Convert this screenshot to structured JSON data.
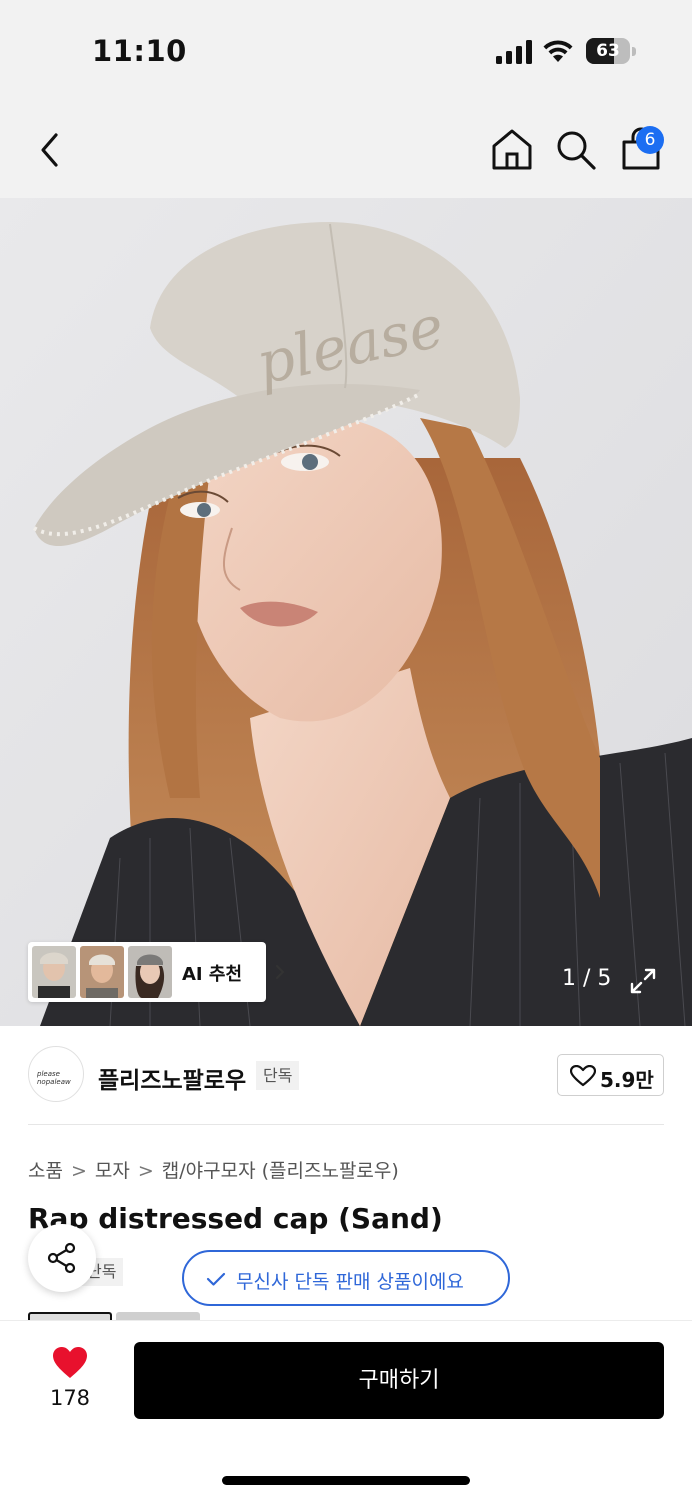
{
  "status_bar": {
    "time": "11:10",
    "battery": "63",
    "battery_level": 0.63
  },
  "nav": {
    "cart_badge": "6"
  },
  "gallery": {
    "ai_label": "AI 추천",
    "counter": "1 / 5",
    "embroidery_text": "please"
  },
  "brand": {
    "logo_text": "please nopaleaw",
    "name": "플리즈노팔로우",
    "tag": "단독",
    "likes": "5.9만"
  },
  "breadcrumb": [
    "소품",
    "모자",
    "캡/야구모자 (플리즈노팔로우)"
  ],
  "product": {
    "title": "Rap distressed cap (Sand)",
    "tag": "단독",
    "exclusive_notice": "무신사 단독 판매 상품이에요"
  },
  "bottom": {
    "wish_count": "178",
    "buy_label": "구매하기"
  },
  "colors": {
    "accent_blue": "#2f67d8",
    "badge_blue": "#1c6ef2",
    "heart_red": "#e8112d",
    "buy_black": "#000000"
  }
}
